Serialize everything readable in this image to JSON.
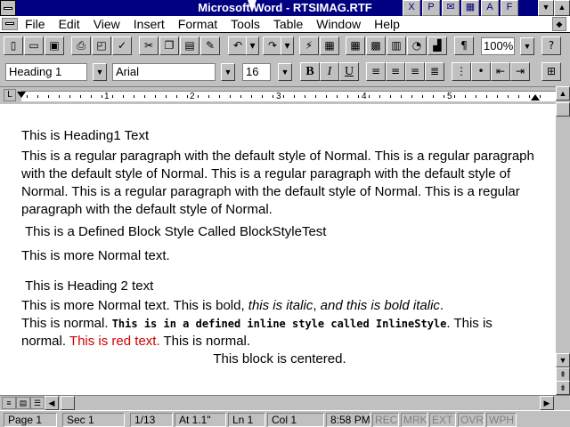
{
  "window": {
    "title": "Microsoft Word - RTSIMAG.RTF"
  },
  "menu": {
    "items": [
      "File",
      "Edit",
      "View",
      "Insert",
      "Format",
      "Tools",
      "Table",
      "Window",
      "Help"
    ]
  },
  "toolbar": {
    "zoom": "100%"
  },
  "format_bar": {
    "style": "Heading 1",
    "font": "Arial",
    "size": "16",
    "bold": "B",
    "italic": "I",
    "underline": "U"
  },
  "ruler": {
    "numbers": [
      "1",
      "2",
      "3",
      "4",
      "5"
    ]
  },
  "document": {
    "heading1": "This is Heading1 Text",
    "para1": "This is a regular paragraph with the default style of Normal. This is a regular paragraph with the default style of Normal. This is a regular paragraph with the default style of Normal. This is a regular paragraph with the default style of Normal. This is a regular paragraph with the default style of Normal.",
    "block_style": "This is a Defined Block Style Called BlockStyleTest",
    "more_normal": "This is more Normal text.",
    "heading2": "This is Heading 2 text",
    "mixed": {
      "t1": "This is more Normal text. This is bold, ",
      "t2": "this is italic",
      "t3": ", ",
      "t4": "and this is bold italic",
      "t5": ".",
      "t6": "This is normal. ",
      "t7": "This is in a defined inline style called InlineStyle",
      "t8": ". This is normal. ",
      "t9": "This is red text.",
      "t10": " This is normal."
    },
    "centered": "This block is centered."
  },
  "status": {
    "page": "Page 1",
    "sec": "Sec 1",
    "pages": "1/13",
    "at": "At 1.1\"",
    "ln": "Ln 1",
    "col": "Col 1",
    "time": "8:58 PM",
    "rec": "REC",
    "mrk": "MRK",
    "ext": "EXT",
    "ovr": "OVR",
    "wph": "WPH"
  },
  "colors": {
    "title_bar": "#000080",
    "red_text": "#d00000"
  }
}
